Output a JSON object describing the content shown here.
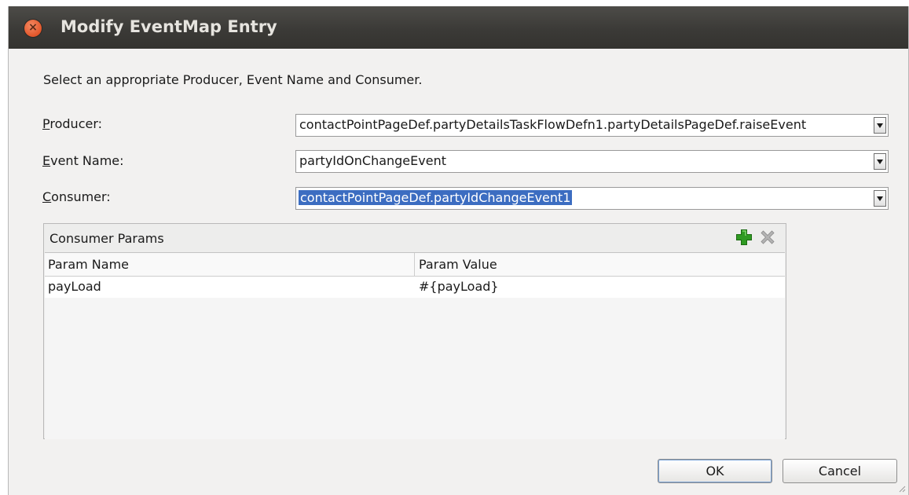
{
  "window": {
    "title": "Modify EventMap Entry"
  },
  "instruction": "Select an appropriate Producer, Event Name and Consumer.",
  "producer": {
    "mnemonic": "P",
    "label_rest": "roducer:",
    "value": "contactPointPageDef.partyDetailsTaskFlowDefn1.partyDetailsPageDef.raiseEvent"
  },
  "event_name": {
    "mnemonic": "E",
    "label_rest": "vent Name:",
    "value": "partyIdOnChangeEvent"
  },
  "consumer": {
    "mnemonic": "C",
    "label_rest": "onsumer:",
    "value": "contactPointPageDef.partyIdChangeEvent1"
  },
  "consumer_params": {
    "title": "Consumer Params",
    "columns": [
      "Param Name",
      "Param Value"
    ],
    "rows": [
      {
        "name": "payLoad",
        "value": "#{payLoad}"
      }
    ],
    "icons": {
      "add": "add-plus-icon",
      "remove": "remove-x-icon"
    }
  },
  "buttons": {
    "ok": "OK",
    "cancel": "Cancel"
  },
  "colors": {
    "titlebar": "#3b3a37",
    "selection": "#3c6dc1",
    "close": "#e2562a",
    "add": "#2f9a22"
  }
}
